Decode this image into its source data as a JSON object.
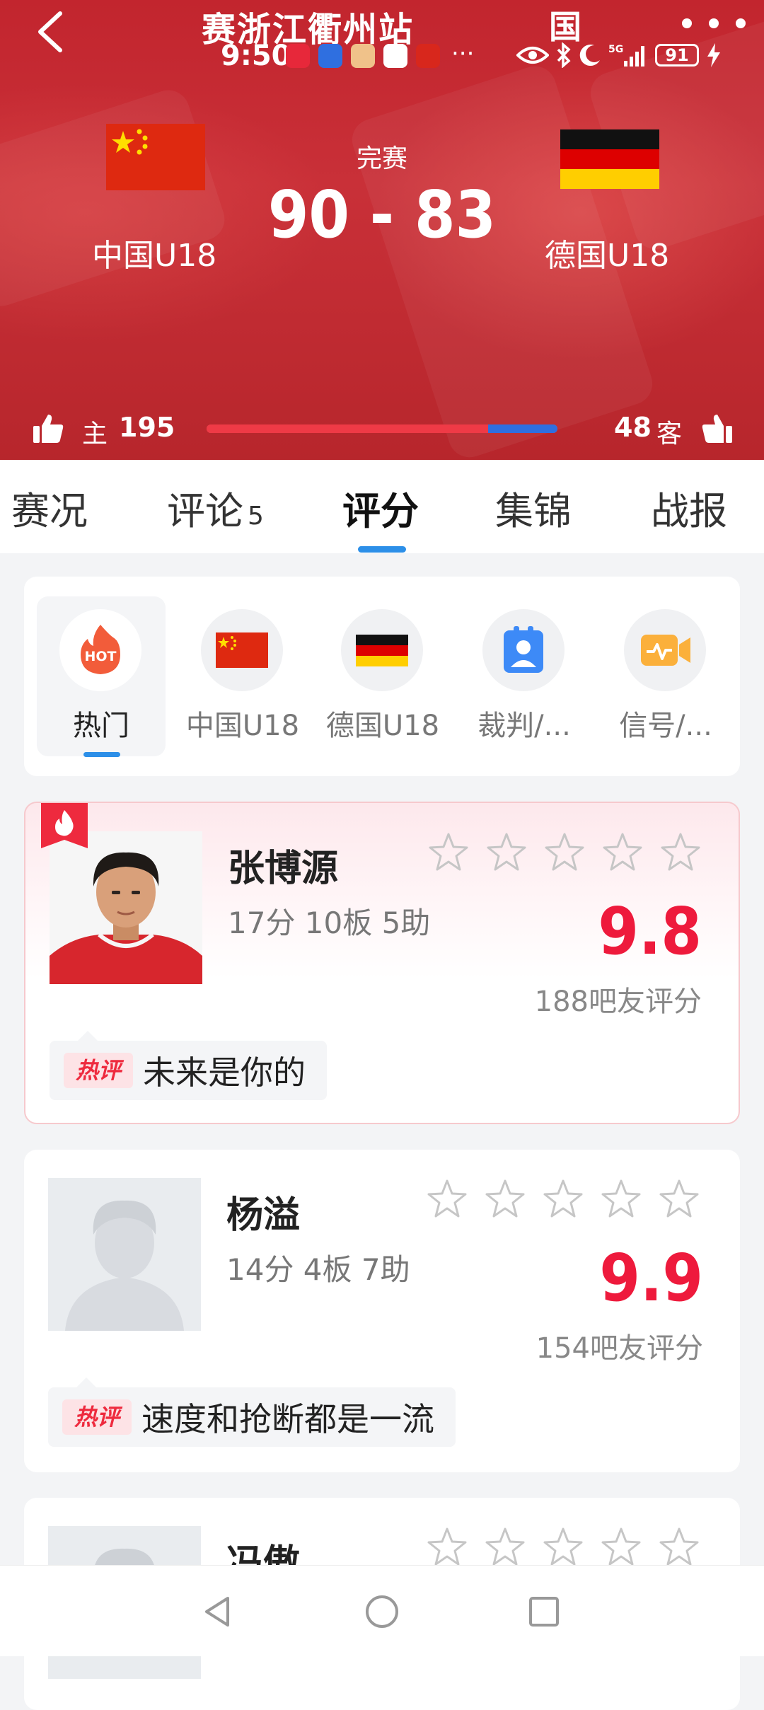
{
  "header": {
    "title": "赛浙江衢州站",
    "title_right": "国"
  },
  "status_bar": {
    "time": "9:50",
    "dots": "···",
    "network": "5G",
    "battery": "91"
  },
  "match": {
    "status": "完赛",
    "home_team": "中国U18",
    "away_team": "德国U18",
    "score": "90 - 83"
  },
  "support": {
    "home_label": "主",
    "home_count": "195",
    "away_label": "客",
    "away_count": "48",
    "home_fraction": 0.802
  },
  "tabs": [
    {
      "label": "赛况",
      "count": ""
    },
    {
      "label": "评论",
      "count": "5"
    },
    {
      "label": "评分",
      "count": ""
    },
    {
      "label": "集锦",
      "count": ""
    },
    {
      "label": "战报",
      "count": ""
    }
  ],
  "filters": [
    {
      "label": "热门",
      "icon": "hot-icon",
      "icon_text": "HOT"
    },
    {
      "label": "中国U18",
      "icon": "china-flag-icon"
    },
    {
      "label": "德国U18",
      "icon": "germany-flag-icon"
    },
    {
      "label": "裁判/...",
      "icon": "referee-icon"
    },
    {
      "label": "信号/...",
      "icon": "broadcast-icon"
    }
  ],
  "players": [
    {
      "name": "张博源",
      "stats": "17分 10板 5助",
      "score": "9.8",
      "votes": "188吧友评分",
      "hot_tag": "热评",
      "hot_comment": "未来是你的"
    },
    {
      "name": "杨溢",
      "stats": "14分 4板 7助",
      "score": "9.9",
      "votes": "154吧友评分",
      "hot_tag": "热评",
      "hot_comment": "速度和抢断都是一流"
    },
    {
      "name": "冯傲",
      "stats": "",
      "score": "",
      "votes": "",
      "hot_tag": "",
      "hot_comment": ""
    }
  ],
  "colors": {
    "header_red": "#c2252e",
    "accent_blue": "#2c8fe8",
    "score_red": "#ee1a3c"
  }
}
